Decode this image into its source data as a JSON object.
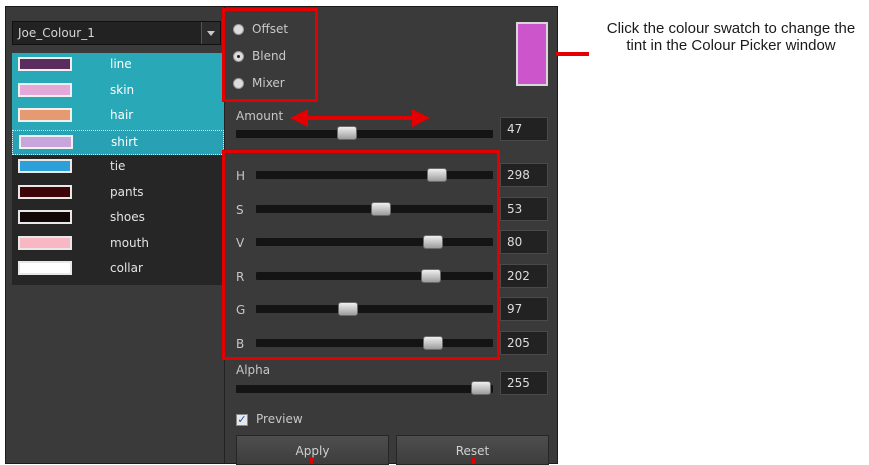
{
  "palette": {
    "name": "Joe_Colour_1",
    "colours": [
      {
        "name": "line",
        "swatch": "#5b2d5f",
        "state": "selected"
      },
      {
        "name": "skin",
        "swatch": "#e4a9d8",
        "state": "selected"
      },
      {
        "name": "hair",
        "swatch": "#e59a72",
        "state": "selected"
      },
      {
        "name": "shirt",
        "swatch": "#c8a6dd",
        "state": "focused"
      },
      {
        "name": "tie",
        "swatch": "#2d9fd9",
        "state": "normal"
      },
      {
        "name": "pants",
        "swatch": "#3d0508",
        "state": "normal"
      },
      {
        "name": "shoes",
        "swatch": "#120707",
        "state": "normal"
      },
      {
        "name": "mouth",
        "swatch": "#f7b8c4",
        "state": "normal"
      },
      {
        "name": "collar",
        "swatch": "#ffffff",
        "state": "normal"
      }
    ]
  },
  "mode": {
    "options": [
      "Offset",
      "Blend",
      "Mixer"
    ],
    "selected": "Blend"
  },
  "tint_swatch_color": "#cc55cc",
  "amount": {
    "label": "Amount",
    "value": "47",
    "level": 47
  },
  "channels": [
    {
      "label": "H",
      "value": "298",
      "fraction": 0.79
    },
    {
      "label": "S",
      "value": "53",
      "fraction": 0.53
    },
    {
      "label": "V",
      "value": "80",
      "fraction": 0.77
    },
    {
      "label": "R",
      "value": "202",
      "fraction": 0.76
    },
    {
      "label": "G",
      "value": "97",
      "fraction": 0.38
    },
    {
      "label": "B",
      "value": "205",
      "fraction": 0.77
    }
  ],
  "alpha": {
    "label": "Alpha",
    "value": "255",
    "fraction": 1.0
  },
  "preview": {
    "label": "Preview",
    "checked": true
  },
  "buttons": {
    "apply": "Apply",
    "reset": "Reset"
  },
  "annotation": {
    "text": "Click the colour swatch to change the tint in the Colour Picker window"
  },
  "accent_red": "#e40000"
}
